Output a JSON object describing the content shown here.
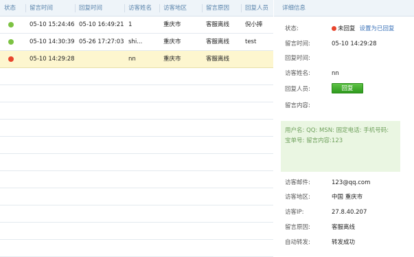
{
  "list": {
    "headers": [
      "状态",
      "留言时间",
      "回复时间",
      "访客姓名",
      "访客地区",
      "留言原因",
      "回复人员"
    ],
    "rows": [
      {
        "status_color": "#7cc242",
        "msg_time": "05-10 15:24:46",
        "reply_time": "05-10 16:49:21",
        "name": "1",
        "region": "重庆市",
        "reason": "客服离线",
        "staff": "倪小捧",
        "selected": false
      },
      {
        "status_color": "#7cc242",
        "msg_time": "05-10 14:30:39",
        "reply_time": "05-26 17:27:03",
        "name": "shi...",
        "region": "重庆市",
        "reason": "客服离线",
        "staff": "test",
        "selected": false
      },
      {
        "status_color": "#e8452d",
        "msg_time": "05-10 14:29:28",
        "reply_time": "",
        "name": "nn",
        "region": "重庆市",
        "reason": "客服离线",
        "staff": "",
        "selected": true
      }
    ]
  },
  "detail": {
    "header": "详细信息",
    "status_label": "状态:",
    "status_value": "未回复",
    "status_dot_color": "#e8452d",
    "set_replied_link": "设置为已回复",
    "msg_time_label": "留言时间:",
    "msg_time_value": "05-10 14:29:28",
    "reply_time_label": "回复时间:",
    "reply_time_value": "",
    "visitor_name_label": "访客姓名:",
    "visitor_name_value": "nn",
    "reply_staff_label": "回复人员:",
    "reply_button": "回复",
    "msg_content_label": "留言内容:",
    "msg_content_value": "",
    "info_box_text": "用户名: QQ: MSN: 固定电话: 手机号码: 宝单号: 留言内容:123",
    "email_label": "访客邮件:",
    "email_value": "123@qq.com",
    "region_label": "访客地区:",
    "region_value": "中国 重庆市",
    "ip_label": "访客IP:",
    "ip_value": "27.8.40.207",
    "reason_label": "留言原因:",
    "reason_value": "客服离线",
    "forward_label": "自动转发:",
    "forward_value": "转发成功"
  },
  "colors": {
    "header_bg": "#eef4f9",
    "header_text": "#5a84ac",
    "selected_row": "#fdf6cf",
    "status_green": "#7cc242",
    "status_red": "#e8452d",
    "reply_button": "#3aa326",
    "info_box_bg": "#eaf6e2"
  }
}
